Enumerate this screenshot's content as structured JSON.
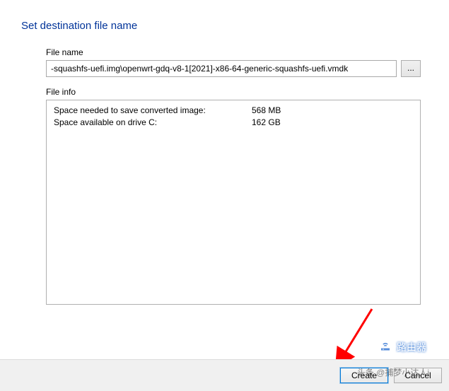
{
  "title": "Set destination file name",
  "file_name_label": "File name",
  "file_name_value": "-squashfs-uefi.img\\openwrt-gdq-v8-1[2021]-x86-64-generic-squashfs-uefi.vmdk",
  "browse_label": "...",
  "file_info_label": "File info",
  "info": {
    "space_needed_label": "Space needed to save converted image:",
    "space_needed_value": "568 MB",
    "space_available_label": "Space available on drive C:",
    "space_available_value": "162 GB"
  },
  "buttons": {
    "create": "Create",
    "cancel": "Cancel"
  },
  "watermark": {
    "brand": "路由器",
    "credit": "头条 @捕梦小达人i"
  }
}
